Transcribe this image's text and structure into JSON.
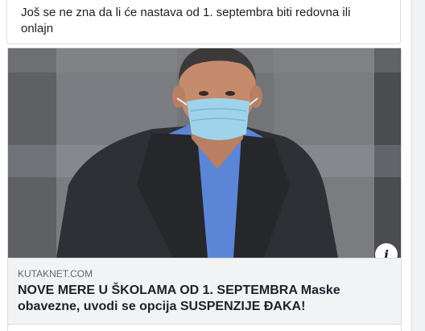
{
  "post": {
    "text": "Još se ne zna da li će nastava od 1. septembra biti redovna ili onlajn"
  },
  "link_preview": {
    "domain": "KUTAKNET.COM",
    "title": "NOVE MERE U ŠKOLAMA OD 1. SEPTEMBRA Maske obavezne, uvodi se opcija SUSPENZIJE ĐAKA!",
    "info_icon": "info-icon",
    "image_subject": "man-in-suit-wearing-face-mask"
  },
  "colors": {
    "card_bg": "#ffffff",
    "meta_bg": "#f2f3f5",
    "border": "#dadde1",
    "domain_text": "#606770",
    "title_text": "#1d2129"
  }
}
